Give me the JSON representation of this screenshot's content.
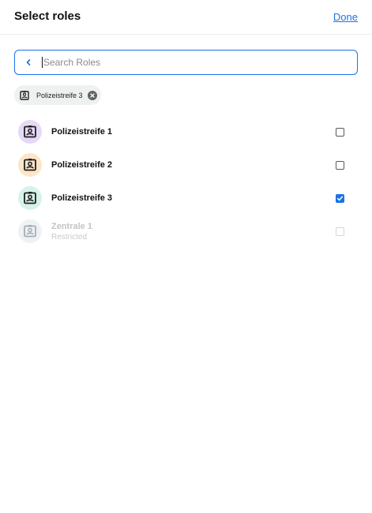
{
  "header": {
    "title": "Select roles",
    "done_label": "Done"
  },
  "search": {
    "placeholder": "Search Roles",
    "value": ""
  },
  "selected_chips": [
    {
      "label": "Polizeistreife 3",
      "icon": "badge-icon"
    }
  ],
  "roles": [
    {
      "name": "Polizeistreife 1",
      "subtitle": "",
      "checked": false,
      "disabled": false,
      "color": "#e6d9f7",
      "icon": "badge-icon"
    },
    {
      "name": "Polizeistreife 2",
      "subtitle": "",
      "checked": false,
      "disabled": false,
      "color": "#fde5c8",
      "icon": "badge-icon"
    },
    {
      "name": "Polizeistreife 3",
      "subtitle": "",
      "checked": true,
      "disabled": false,
      "color": "#d6f3ea",
      "icon": "badge-icon"
    },
    {
      "name": "Zentrale 1",
      "subtitle": "Restricted",
      "checked": false,
      "disabled": true,
      "color": "#eef1f5",
      "icon": "badge-icon"
    }
  ],
  "colors": {
    "accent": "#1a73e8",
    "icon_dark": "#1f1f1f",
    "icon_disabled": "#a9aeb5"
  }
}
